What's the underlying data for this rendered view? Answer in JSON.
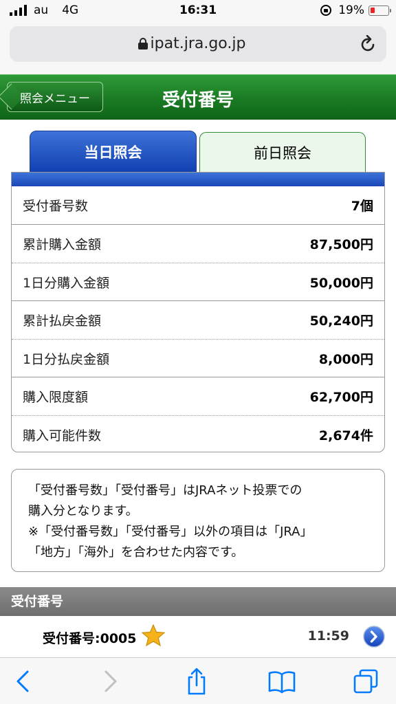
{
  "status_bar": {
    "carrier": "au",
    "network": "4G",
    "time": "16:31",
    "battery": "19%"
  },
  "browser": {
    "url": "ipat.jra.go.jp"
  },
  "header": {
    "back_label": "照会メニュー",
    "title": "受付番号"
  },
  "tabs": [
    {
      "label": "当日照会",
      "active": true
    },
    {
      "label": "前日照会",
      "active": false
    }
  ],
  "summary": {
    "groups": [
      [
        {
          "label": "受付番号数",
          "value": "7個"
        }
      ],
      [
        {
          "label": "累計購入金額",
          "value": "87,500円"
        },
        {
          "label": "1日分購入金額",
          "value": "50,000円"
        }
      ],
      [
        {
          "label": "累計払戻金額",
          "value": "50,240円"
        },
        {
          "label": "1日分払戻金額",
          "value": "8,000円"
        }
      ],
      [
        {
          "label": "購入限度額",
          "value": "62,700円"
        },
        {
          "label": "購入可能件数",
          "value": "2,674件"
        }
      ]
    ]
  },
  "note": {
    "lines": [
      "「受付番号数」「受付番号」はJRAネット投票での",
      "購入分となります。",
      "※「受付番号数」「受付番号」以外の項目は「JRA」",
      "「地方」「海外」を合わせた内容です。"
    ]
  },
  "section": {
    "title": "受付番号",
    "items": [
      {
        "label": "受付番号:0005",
        "time": "11:59"
      }
    ]
  },
  "colors": {
    "header_green": "#1a7a23",
    "tab_blue": "#1140b1",
    "tab_inactive_bg": "#eaf7ea",
    "star": "#f6b21b",
    "battery_low": "#e22222",
    "ios_blue": "#007aff"
  },
  "icons": [
    "signal-icon",
    "lock-rotation-icon",
    "battery-icon",
    "lock-icon",
    "reload-icon",
    "star-icon",
    "chevron-right-circle-icon",
    "back-arrow-icon",
    "forward-arrow-icon",
    "share-icon",
    "bookmarks-icon",
    "tabs-icon"
  ]
}
